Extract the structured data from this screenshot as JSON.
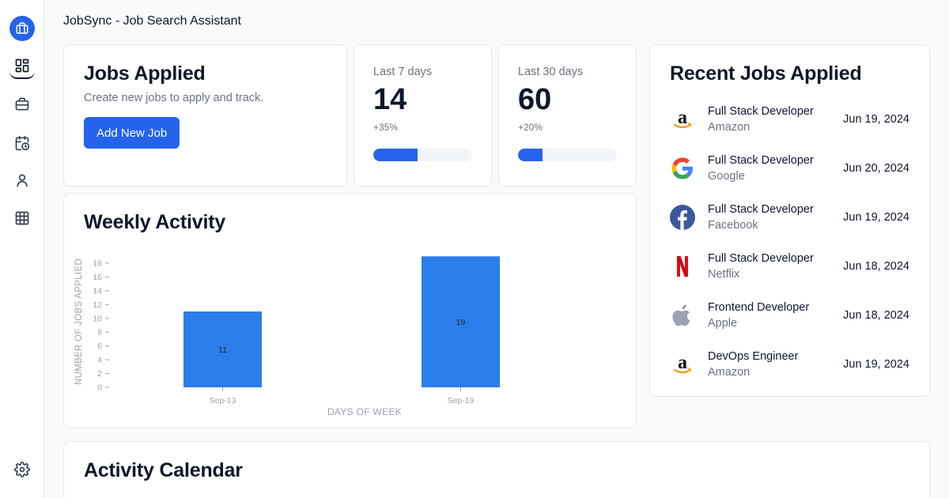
{
  "app": {
    "title": "JobSync - Job Search Assistant"
  },
  "sidebar": {
    "items": [
      {
        "icon": "briefcase-logo-icon"
      },
      {
        "icon": "dashboard-icon",
        "active": true
      },
      {
        "icon": "briefcase-icon"
      },
      {
        "icon": "calendar-clock-icon"
      },
      {
        "icon": "user-icon"
      },
      {
        "icon": "table-icon"
      },
      {
        "icon": "gear-icon"
      }
    ]
  },
  "jobs_applied": {
    "title": "Jobs Applied",
    "subtitle": "Create new jobs to apply and track.",
    "button_label": "Add New Job"
  },
  "stats": [
    {
      "label": "Last 7 days",
      "value": "14",
      "change": "+35%",
      "progress": 0.45
    },
    {
      "label": "Last 30 days",
      "value": "60",
      "change": "+20%",
      "progress": 0.25
    }
  ],
  "recent": {
    "title": "Recent Jobs Applied",
    "items": [
      {
        "title": "Full Stack Developer",
        "company": "Amazon",
        "date": "Jun 19, 2024",
        "logo": "amazon-logo-icon"
      },
      {
        "title": "Full Stack Developer",
        "company": "Google",
        "date": "Jun 20, 2024",
        "logo": "google-logo-icon"
      },
      {
        "title": "Full Stack Developer",
        "company": "Facebook",
        "date": "Jun 19, 2024",
        "logo": "facebook-logo-icon"
      },
      {
        "title": "Full Stack Developer",
        "company": "Netflix",
        "date": "Jun 18, 2024",
        "logo": "netflix-logo-icon"
      },
      {
        "title": "Frontend Developer",
        "company": "Apple",
        "date": "Jun 18, 2024",
        "logo": "apple-logo-icon"
      },
      {
        "title": "DevOps Engineer",
        "company": "Amazon",
        "date": "Jun 19, 2024",
        "logo": "amazon-logo-icon"
      }
    ]
  },
  "weekly": {
    "title": "Weekly Activity"
  },
  "calendar": {
    "title": "Activity Calendar"
  },
  "colors": {
    "accent": "#2563eb",
    "bar": "#2b7de9"
  },
  "chart_data": {
    "type": "bar",
    "categories": [
      "Sep-13",
      "Sep-19"
    ],
    "values": [
      11,
      19
    ],
    "xlabel": "DAYS OF WEEK",
    "ylabel": "NUMBER OF JOBS APPLIED",
    "ylim": [
      0,
      18
    ],
    "yticks": [
      0,
      2,
      4,
      6,
      8,
      10,
      12,
      14,
      16,
      18
    ],
    "data_labels": true,
    "grid": false
  }
}
